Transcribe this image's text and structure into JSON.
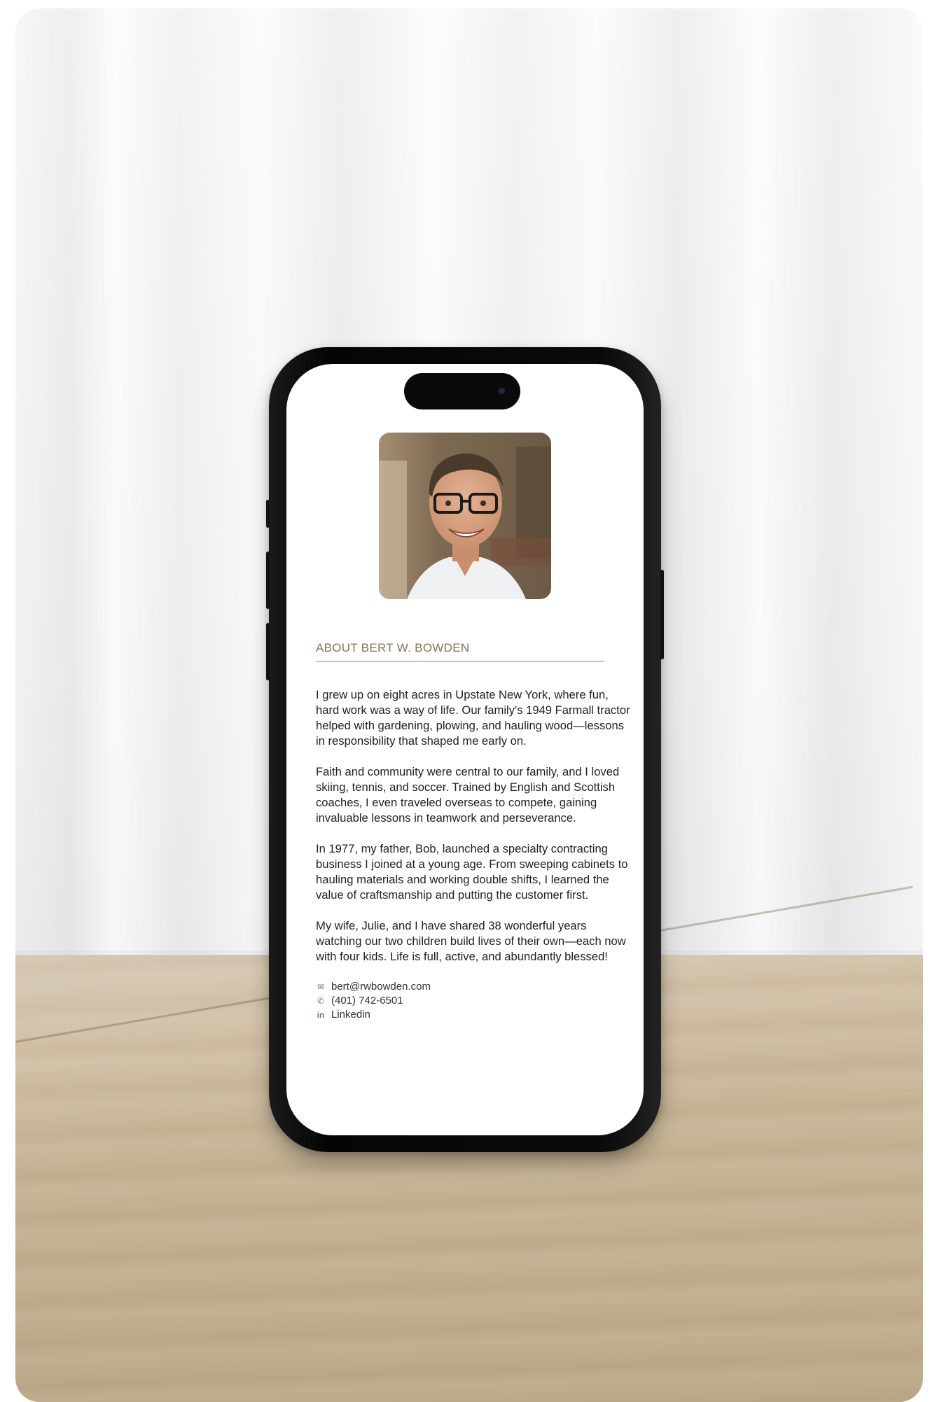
{
  "profile": {
    "section_title": "ABOUT BERT W. BOWDEN",
    "paragraphs": [
      "I grew up on eight acres in Upstate New York, where fun, hard work was a way of life. Our family's 1949 Farmall tractor helped with gardening, plowing, and hauling wood—lessons in responsibility that shaped me early on.",
      "Faith and community were central to our family, and I loved skiing, tennis, and soccer. Trained by English and Scottish coaches, I even traveled overseas to compete, gaining invaluable lessons in teamwork and perseverance.",
      "In 1977, my father, Bob, launched a specialty contracting business I joined at a young age. From sweeping cabinets to hauling materials and working double shifts, I learned the value of craftsmanship and putting the customer first.",
      "My wife, Julie, and I have shared 38 wonderful years watching our two children build lives of their own—each now with four kids. Life is full, active, and abundantly blessed!"
    ],
    "contacts": {
      "email": "bert@rwbowden.com",
      "phone": "(401) 742-6501",
      "linkedin": "Linkedin"
    }
  },
  "icons": {
    "email": "mail-icon",
    "phone": "phone-icon",
    "linkedin": "linkedin-icon"
  },
  "colors": {
    "accent": "#8a7255",
    "rule": "#c9c2b8",
    "text": "#1f1f1f"
  }
}
